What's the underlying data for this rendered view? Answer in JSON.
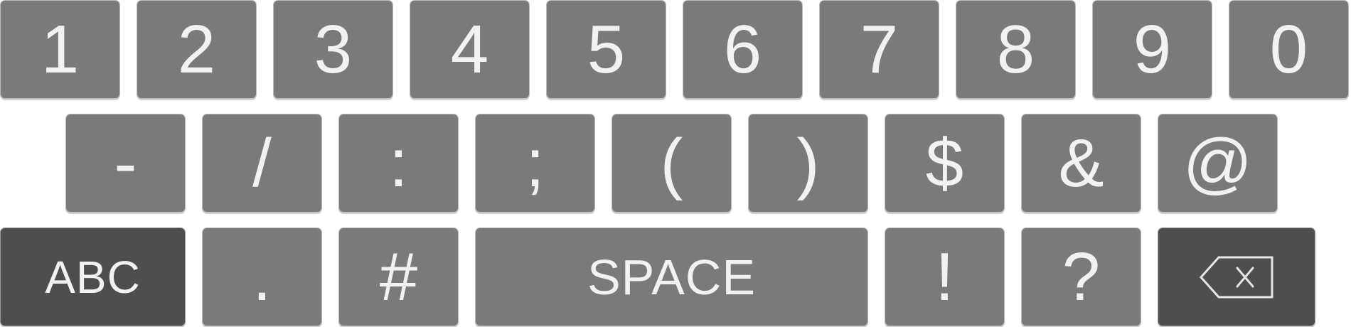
{
  "keyboard": {
    "row1": [
      "1",
      "2",
      "3",
      "4",
      "5",
      "6",
      "7",
      "8",
      "9",
      "0"
    ],
    "row2": [
      "-",
      "/",
      ":",
      ";",
      "(",
      ")",
      "$",
      "&",
      "@"
    ],
    "row3": {
      "abc": "ABC",
      "period": ".",
      "hash": "#",
      "space": "SPACE",
      "exclaim": "!",
      "question": "?",
      "backspace_icon": "backspace-icon"
    }
  },
  "colors": {
    "key": "#7a7a7a",
    "dark_key": "#4e4e4e",
    "label": "#f2f2f2"
  }
}
